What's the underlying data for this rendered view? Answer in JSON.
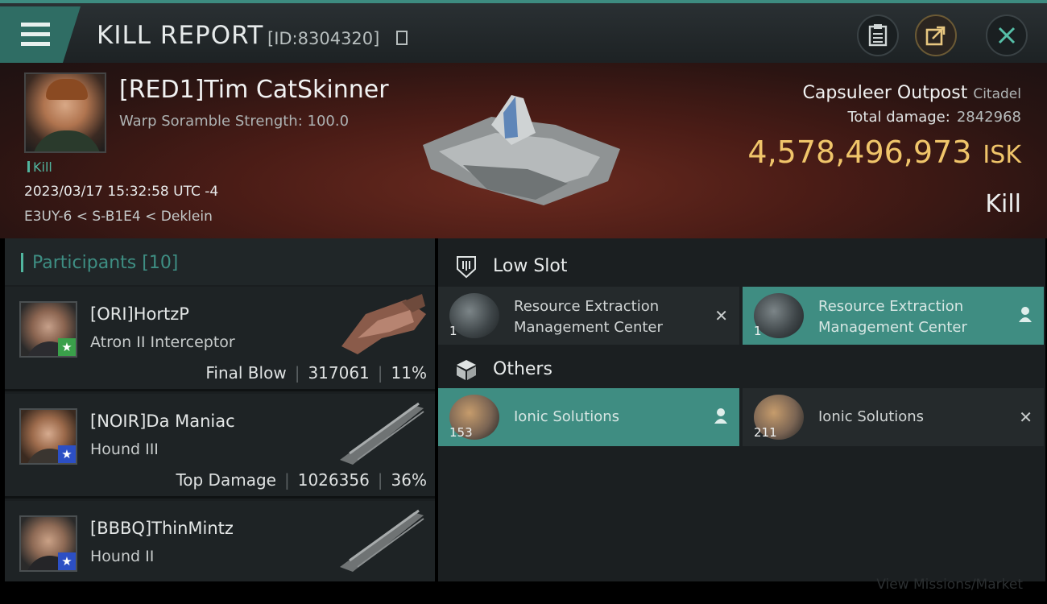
{
  "header": {
    "title": "KILL REPORT",
    "report_id": "[ID:8304320]",
    "menu_icon": "hamburger-menu-icon",
    "buttons": [
      {
        "name": "clipboard-icon"
      },
      {
        "name": "share-icon"
      },
      {
        "name": "close-icon"
      }
    ]
  },
  "victim": {
    "name": "[RED1]Tim CatSkinner",
    "subtitle": "Warp Soramble Strength: 100.0",
    "kill_tag": "Kill",
    "datetime": "2023/03/17 15:32:58 UTC -4",
    "location": "E3UY-6 < S-B1E4 < Deklein",
    "ship_name": "Capsuleer Outpost",
    "ship_class": "Citadel",
    "damage_label": "Total damage:",
    "damage_value": "2842968",
    "isk_value": "4,578,496,973",
    "isk_unit": "ISK",
    "result": "Kill"
  },
  "participants": {
    "title": "Participants",
    "count": "[10]",
    "rows": [
      {
        "name": "[ORI]HortzP",
        "ship": "Atron II Interceptor",
        "stat_label": "Final Blow",
        "damage": "317061",
        "percent": "11%",
        "badge_color": "#3aa04a"
      },
      {
        "name": "[NOIR]Da Maniac",
        "ship": "Hound III",
        "stat_label": "Top Damage",
        "damage": "1026356",
        "percent": "36%",
        "badge_color": "#2c4fc4"
      },
      {
        "name": "[BBBQ]ThinMintz",
        "ship": "Hound II",
        "stat_label": "",
        "damage": "",
        "percent": "",
        "badge_color": "#2c4fc4"
      }
    ]
  },
  "fitting": {
    "low_slot": {
      "title": "Low Slot",
      "items": [
        {
          "qty": "1",
          "name": "Resource Extraction Management Center",
          "action_icon": "close-icon",
          "highlight": false
        },
        {
          "qty": "1",
          "name": "Resource Extraction Management Center",
          "action_icon": "person-icon",
          "highlight": true
        }
      ]
    },
    "others": {
      "title": "Others",
      "items": [
        {
          "qty": "153",
          "name": "Ionic Solutions",
          "action_icon": "person-icon",
          "highlight": true
        },
        {
          "qty": "211",
          "name": "Ionic Solutions",
          "action_icon": "close-icon",
          "highlight": false
        }
      ]
    }
  },
  "footer": {
    "text": "View Missions/Market"
  },
  "colors": {
    "accent": "#3f8d82",
    "isk": "#f0c56a",
    "banner": "#4a1c16"
  }
}
